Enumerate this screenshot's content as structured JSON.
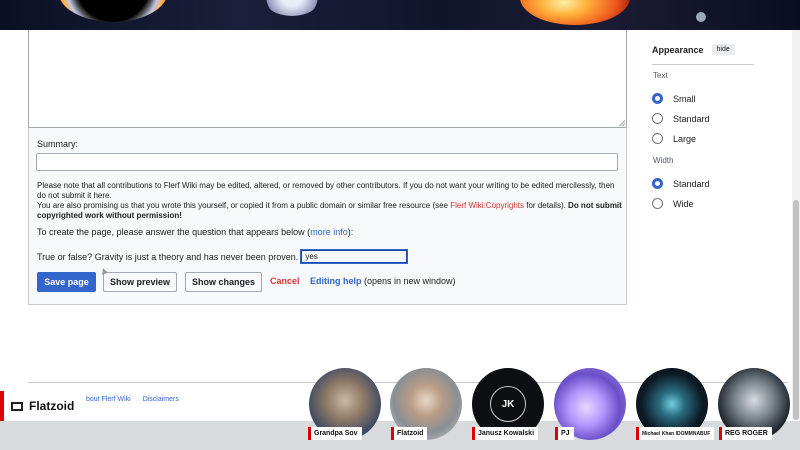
{
  "editor": {
    "summary_label": "Summary:",
    "notice_1": "Please note that all contributions to Flerf Wiki may be edited, altered, or removed by other contributors. If you do not want your writing to be edited mercilessly, then do not submit it here.",
    "notice_2_pre": "You are also promising us that you wrote this yourself, or copied it from a public domain or similar free resource (see ",
    "notice_2_link": "Flerf Wiki:Copyrights",
    "notice_2_post": " for details). ",
    "notice_2_bold": "Do not submit copyrighted work without permission!",
    "captcha_intro_pre": "To create the page, please answer the question that appears below (",
    "captcha_intro_link": "more info",
    "captcha_intro_post": "):",
    "question": "True or false? Gravity is just a theory and has never been proven.",
    "answer": "yes",
    "save_label": "Save page",
    "preview_label": "Show preview",
    "changes_label": "Show changes",
    "cancel_label": "Cancel",
    "help_label": "Editing help",
    "help_suffix": " (opens in new window)"
  },
  "appearance": {
    "title": "Appearance",
    "hide_label": "hide",
    "text_label": "Text",
    "text_options": [
      "Small",
      "Standard",
      "Large"
    ],
    "text_selected": "Small",
    "width_label": "Width",
    "width_options": [
      "Standard",
      "Wide"
    ],
    "width_selected": "Standard"
  },
  "footer": {
    "links": [
      "bout Flerf Wiki",
      "Disclaimers"
    ]
  },
  "stream": {
    "brand": "Flatzoid",
    "participants": [
      {
        "name": "Grandpa Sov",
        "initials": ""
      },
      {
        "name": "Flatzoid",
        "initials": ""
      },
      {
        "name": "Janusz Kowalski",
        "initials": "JK"
      },
      {
        "name": "PJ",
        "initials": ""
      },
      {
        "name": "Michael Khan IDOMMNABUF",
        "initials": ""
      },
      {
        "name": "REG ROGER",
        "initials": ""
      }
    ]
  },
  "colors": {
    "accent": "#3366cc",
    "cancel": "#dd3333",
    "brand_red": "#e00000"
  }
}
